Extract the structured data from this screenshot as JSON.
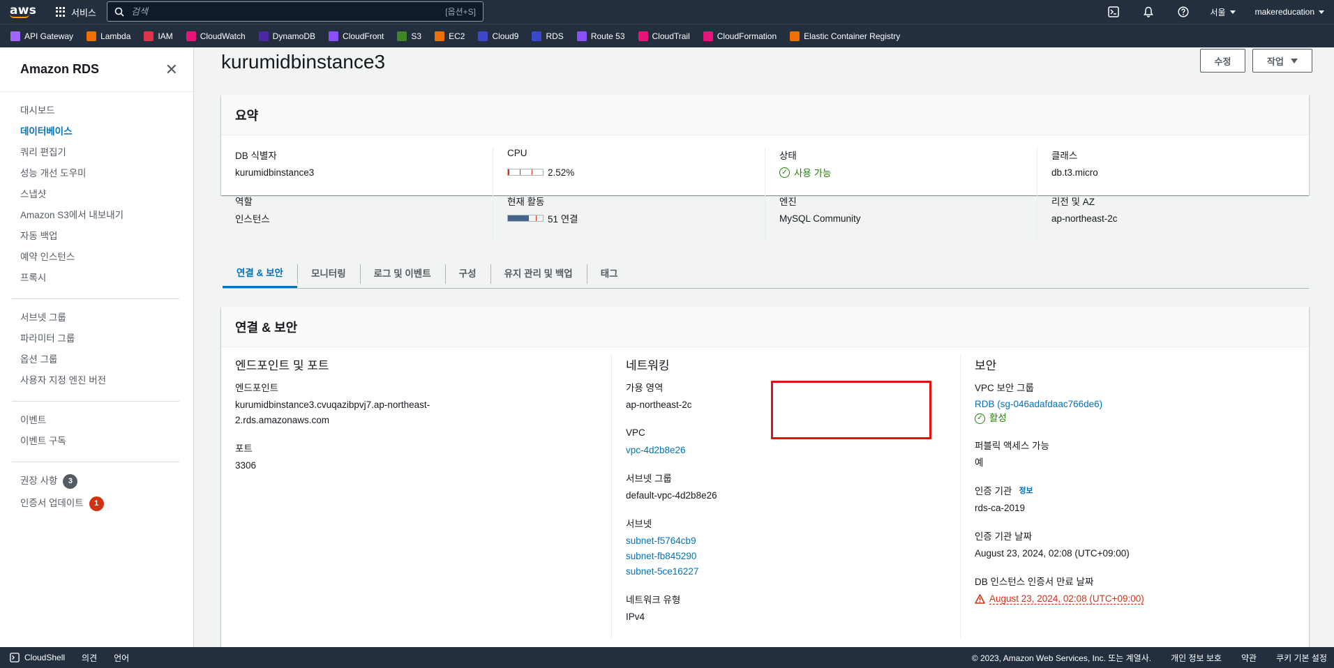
{
  "topbar": {
    "logo": "aws",
    "services_label": "서비스",
    "search_placeholder": "검색",
    "search_shortcut": "[옵션+S]",
    "region": "서울",
    "account": "makereducation"
  },
  "favorites": [
    {
      "label": "API Gateway",
      "color": "#a166ff"
    },
    {
      "label": "Lambda",
      "color": "#ed7100"
    },
    {
      "label": "IAM",
      "color": "#dd344c"
    },
    {
      "label": "CloudWatch",
      "color": "#e7157b"
    },
    {
      "label": "DynamoDB",
      "color": "#4d27a8"
    },
    {
      "label": "CloudFront",
      "color": "#8c4fff"
    },
    {
      "label": "S3",
      "color": "#3f8624"
    },
    {
      "label": "EC2",
      "color": "#ed7100"
    },
    {
      "label": "Cloud9",
      "color": "#3b48cc"
    },
    {
      "label": "RDS",
      "color": "#3b48cc"
    },
    {
      "label": "Route 53",
      "color": "#8c4fff"
    },
    {
      "label": "CloudTrail",
      "color": "#e7157b"
    },
    {
      "label": "CloudFormation",
      "color": "#e7157b"
    },
    {
      "label": "Elastic Container Registry",
      "color": "#ed7100"
    }
  ],
  "sidebar": {
    "title": "Amazon RDS",
    "group1": [
      "대시보드",
      "데이터베이스",
      "쿼리 편집기",
      "성능 개선 도우미",
      "스냅샷",
      "Amazon S3에서 내보내기",
      "자동 백업",
      "예약 인스턴스",
      "프록시"
    ],
    "group2": [
      "서브넷 그룹",
      "파라미터 그룹",
      "옵션 그룹",
      "사용자 지정 엔진 버전"
    ],
    "group3": [
      "이벤트",
      "이벤트 구독"
    ],
    "recommendations": {
      "label": "권장 사항",
      "count": "3"
    },
    "cert_update": {
      "label": "인증서 업데이트",
      "count": "1"
    }
  },
  "page": {
    "title": "kurumidbinstance3",
    "modify_btn": "수정",
    "actions_btn": "작업"
  },
  "summary": {
    "heading": "요약",
    "db_id_label": "DB 식별자",
    "db_id": "kurumidbinstance3",
    "role_label": "역할",
    "role": "인스턴스",
    "cpu_label": "CPU",
    "cpu_value": "2.52%",
    "cpu_fraction": 0.0252,
    "activity_label": "현재 활동",
    "activity_value": "51 연결",
    "activity_fraction": 0.6,
    "status_label": "상태",
    "status": "사용 가능",
    "engine_label": "엔진",
    "engine": "MySQL Community",
    "class_label": "클래스",
    "class": "db.t3.micro",
    "region_label": "리전 및 AZ",
    "region": "ap-northeast-2c"
  },
  "tabs": [
    "연결 & 보안",
    "모니터링",
    "로그 및 이벤트",
    "구성",
    "유지 관리 및 백업",
    "태그"
  ],
  "connectivity": {
    "heading": "연결 & 보안",
    "endpoint_title": "엔드포인트 및 포트",
    "endpoint_label": "엔드포인트",
    "endpoint_line1": "kurumidbinstance3.cvuqazibpvj7.ap-northeast-",
    "endpoint_line2": "2.rds.amazonaws.com",
    "port_label": "포트",
    "port": "3306",
    "network_title": "네트워킹",
    "az_label": "가용 영역",
    "az": "ap-northeast-2c",
    "vpc_label": "VPC",
    "vpc": "vpc-4d2b8e26",
    "subnet_group_label": "서브넷 그룹",
    "subnet_group": "default-vpc-4d2b8e26",
    "subnets_label": "서브넷",
    "subnets": [
      "subnet-f5764cb9",
      "subnet-fb845290",
      "subnet-5ce16227"
    ],
    "network_type_label": "네트워크 유형",
    "network_type": "IPv4",
    "security_title": "보안",
    "sg_label": "VPC 보안 그룹",
    "sg_link": "RDB (sg-046adafdaac766de6)",
    "sg_status": "활성",
    "public_label": "퍼블릭 액세스 가능",
    "public": "예",
    "ca_label": "인증 기관",
    "ca_info": "정보",
    "ca": "rds-ca-2019",
    "ca_date_label": "인증 기관 날짜",
    "ca_date": "August 23, 2024, 02:08 (UTC+09:00)",
    "cert_expiry_label": "DB 인스턴스 인증서 만료 날짜",
    "cert_expiry": "August 23, 2024, 02:08 (UTC+09:00)"
  },
  "footer": {
    "cloudshell": "CloudShell",
    "feedback": "의견",
    "language": "언어",
    "copyright": "© 2023, Amazon Web Services, Inc. 또는 계열사.",
    "privacy": "개인 정보 보호",
    "terms": "약관",
    "cookies": "쿠키 기본 설정"
  },
  "colors": {
    "nav_bg": "#232f3e",
    "link": "#0073bb",
    "success": "#1d8102",
    "error": "#d13212",
    "highlight": "#e31010"
  }
}
